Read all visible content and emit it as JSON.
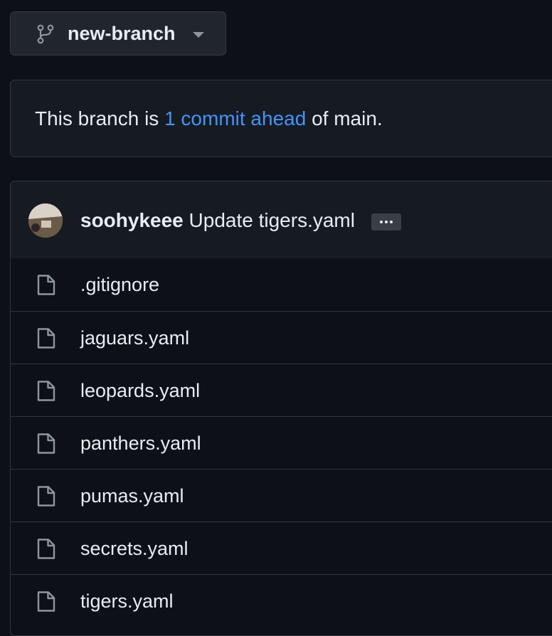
{
  "branch": {
    "name": "new-branch",
    "icon": "git-branch-icon"
  },
  "notice": {
    "prefix": "This branch is ",
    "link": "1 commit ahead",
    "suffix": " of main."
  },
  "commit": {
    "author": "soohykeee",
    "message": "Update tigers.yaml",
    "ellipsis": "..."
  },
  "files": [
    {
      "name": ".gitignore",
      "icon": "file-icon"
    },
    {
      "name": "jaguars.yaml",
      "icon": "file-icon"
    },
    {
      "name": "leopards.yaml",
      "icon": "file-icon"
    },
    {
      "name": "panthers.yaml",
      "icon": "file-icon"
    },
    {
      "name": "pumas.yaml",
      "icon": "file-icon"
    },
    {
      "name": "secrets.yaml",
      "icon": "file-icon"
    },
    {
      "name": "tigers.yaml",
      "icon": "file-icon"
    }
  ],
  "colors": {
    "background": "#0d1117",
    "surface": "#161b22",
    "border": "#30363d",
    "link": "#4493f8",
    "text": "#e6edf3",
    "icon": "#8d96a0"
  }
}
